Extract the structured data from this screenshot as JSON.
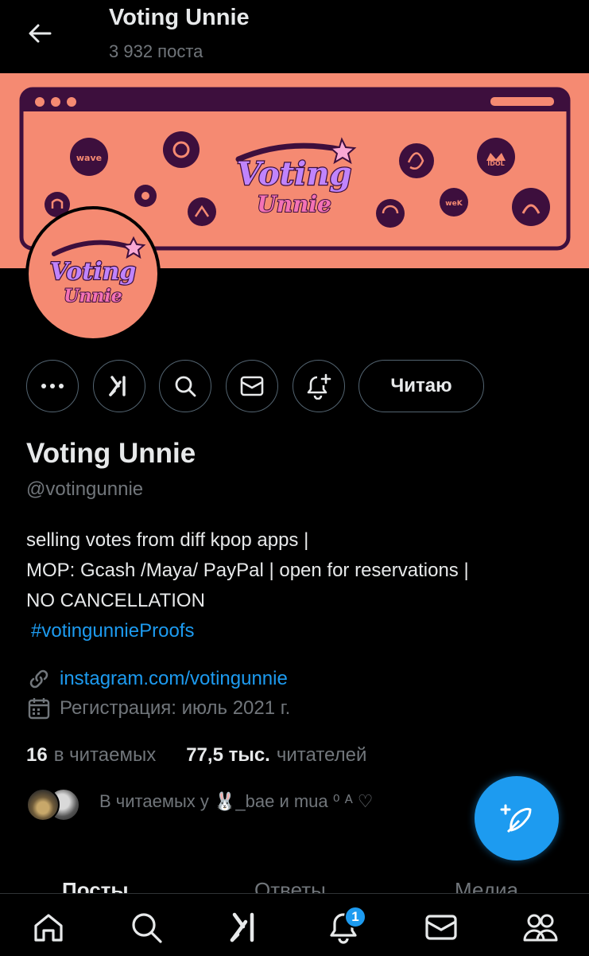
{
  "header": {
    "title": "Voting Unnie",
    "posts_count": "3 932 поста"
  },
  "banner": {
    "logo_line1": "Voting",
    "logo_line2": "Unnie",
    "icon_labels": [
      "wave",
      "IDOL",
      "weK"
    ]
  },
  "avatar": {
    "logo_line1": "Voting",
    "logo_line2": "Unnie"
  },
  "actions": {
    "follow_label": "Читаю"
  },
  "profile": {
    "name": "Voting Unnie",
    "handle": "@votingunnie",
    "bio_lines": [
      "selling votes from diff kpop apps |",
      "MOP: Gcash /Maya/ PayPal | open for reservations |",
      "NO CANCELLATION"
    ],
    "hashtag": "#votingunnieProofs",
    "link": "instagram.com/votingunnie",
    "joined": "Регистрация: июль 2021 г."
  },
  "stats": {
    "following_count": "16",
    "following_label": "в читаемых",
    "followers_count": "77,5 тыс.",
    "followers_label": "читателей"
  },
  "followed_by": {
    "text": "В читаемых у 🐰_bae и mua ⁰ ᴬ ♡"
  },
  "tabs": [
    "Посты",
    "Ответы",
    "Медиа"
  ],
  "nav": {
    "notification_count": "1"
  },
  "colors": {
    "accent": "#1d9bf0",
    "banner": "#f58a72",
    "banner_dark": "#3d0f3d",
    "logo_purple": "#c084fc"
  }
}
